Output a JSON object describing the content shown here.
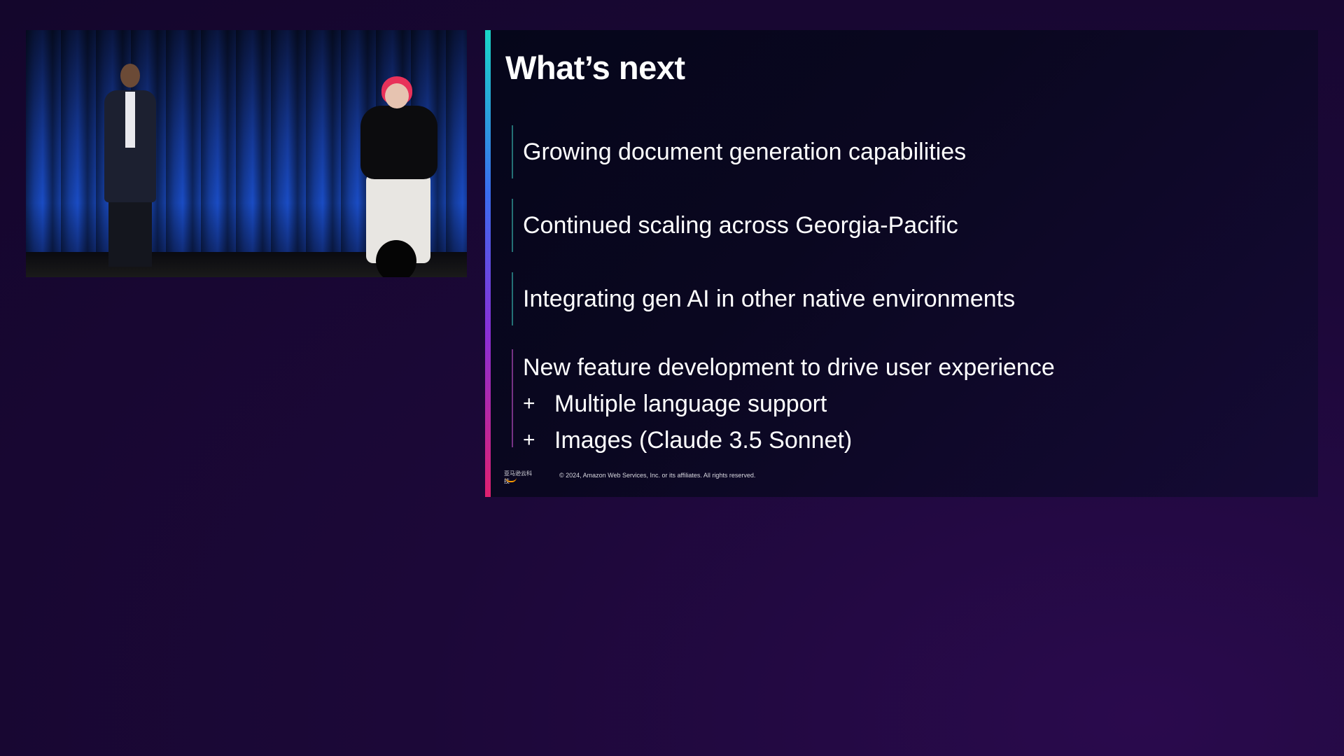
{
  "video": {
    "description_icon": "stage-video-feed"
  },
  "slide": {
    "title": "What’s next",
    "bullets": [
      "Growing document generation capabilities",
      "Continued scaling across Georgia-Pacific",
      "Integrating gen AI in other native environments",
      "New feature development to drive user experience"
    ],
    "sub_bullets": [
      {
        "marker": "+",
        "text": "Multiple language support"
      },
      {
        "marker": "+",
        "text": "Images (Claude 3.5 Sonnet)"
      }
    ],
    "footer": {
      "logo_text": "亚马逊云科技",
      "copyright": "© 2024, Amazon Web Services, Inc. or its affiliates. All rights reserved."
    },
    "accent_colors": [
      "#19d6c8",
      "#3a6cf0",
      "#8a2fd6",
      "#e0206f"
    ]
  }
}
